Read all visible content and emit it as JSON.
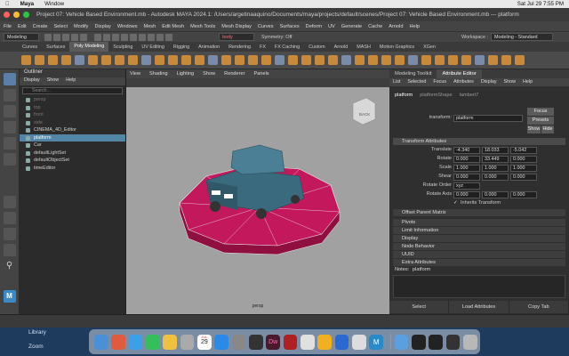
{
  "mac_menubar": {
    "app": "Maya",
    "menu1": "Window",
    "clock": "Sat Jul 29  7:55 PM"
  },
  "window_title": "Project 07: Vehicle Based Environment.mb - Autodesk MAYA 2024.1: /Users/argetinaaquino/Documents/maya/projects/default/scenes/Project 07: Vehicle Based Environment.mb  ---  platform",
  "main_menu": [
    "File",
    "Edit",
    "Create",
    "Select",
    "Modify",
    "Display",
    "Windows",
    "Mesh",
    "Edit Mesh",
    "Mesh Tools",
    "Mesh Display",
    "Curves",
    "Surfaces",
    "Deform",
    "UV",
    "Generate",
    "Cache",
    "Arnold",
    "Help"
  ],
  "workspace": {
    "label": "Workspace :",
    "value": "Modeling - Standard"
  },
  "toolrow": {
    "menuset": "Modeling",
    "symmetry": "Symmetry: Off",
    "object_field": "body"
  },
  "shelf_tabs": [
    "Curves",
    "Surfaces",
    "Poly Modeling",
    "Sculpting",
    "UV Editing",
    "Rigging",
    "Animation",
    "Rendering",
    "FX",
    "FX Caching",
    "Custom",
    "Arnold",
    "MASH",
    "Motion Graphics",
    "XGen"
  ],
  "shelf_active": "Poly Modeling",
  "outliner": {
    "title": "Outliner",
    "menu": [
      "Display",
      "Show",
      "Help"
    ],
    "search_placeholder": "Search...",
    "items": [
      {
        "label": "persp",
        "dim": true
      },
      {
        "label": "top",
        "dim": true
      },
      {
        "label": "front",
        "dim": true
      },
      {
        "label": "side",
        "dim": true
      },
      {
        "label": "CINEMA_4D_Editor",
        "dim": false
      },
      {
        "label": "platform",
        "dim": false,
        "selected": true
      },
      {
        "label": "Car",
        "dim": false
      },
      {
        "label": "defaultLightSet",
        "dim": false
      },
      {
        "label": "defaultObjectSet",
        "dim": false
      },
      {
        "label": "timeEditor",
        "dim": false
      }
    ]
  },
  "viewport": {
    "menu": [
      "View",
      "Shading",
      "Lighting",
      "Show",
      "Renderer",
      "Panels"
    ],
    "camera_label": "persp",
    "viewcube_label": "BACK"
  },
  "attribute_editor": {
    "tabs": [
      "Modeling Toolkit",
      "Attribute Editor"
    ],
    "active_tab": "Attribute Editor",
    "menu": [
      "List",
      "Selected",
      "Focus",
      "Attributes",
      "Display",
      "Show",
      "Help"
    ],
    "node_tabs": [
      "platform",
      "platformShape",
      "lambert7"
    ],
    "transform_label": "transform:",
    "transform_value": "platform",
    "buttons": {
      "focus": "Focus",
      "presets": "Presets",
      "show": "Show",
      "hide": "Hide"
    },
    "section_transform": "Transform Attributes",
    "translate": {
      "label": "Translate",
      "x": "-4.340",
      "y": "18.033",
      "z": "-5.042"
    },
    "rotate": {
      "label": "Rotate",
      "x": "0.000",
      "y": "33.449",
      "z": "0.000"
    },
    "scale": {
      "label": "Scale",
      "x": "1.000",
      "y": "1.000",
      "z": "1.000"
    },
    "shear": {
      "label": "Shear",
      "x": "0.000",
      "y": "0.000",
      "z": "0.000"
    },
    "rotate_order": {
      "label": "Rotate Order",
      "value": "xyz"
    },
    "rotate_axis": {
      "label": "Rotate Axis",
      "x": "0.000",
      "y": "0.000",
      "z": "0.000"
    },
    "inherits": "Inherits Transform",
    "offset_parent": "Offset Parent Matrix",
    "sections": [
      "Pivots",
      "Limit Information",
      "Display",
      "Node Behavior",
      "UUID",
      "Extra Attributes"
    ],
    "notes_label": "Notes:",
    "notes_value": "platform",
    "bottom_buttons": [
      "Select",
      "Load Attributes",
      "Copy Tab"
    ]
  },
  "finder_sidebar": [
    "Library",
    "Zoom"
  ],
  "dock": {
    "calendar_month": "JUL",
    "calendar_day": "29"
  },
  "colors": {
    "platform": "#c4185c",
    "car": "#3a6a7e",
    "viewport_bg": "#a1a1a1",
    "selection": "#5285a6"
  }
}
